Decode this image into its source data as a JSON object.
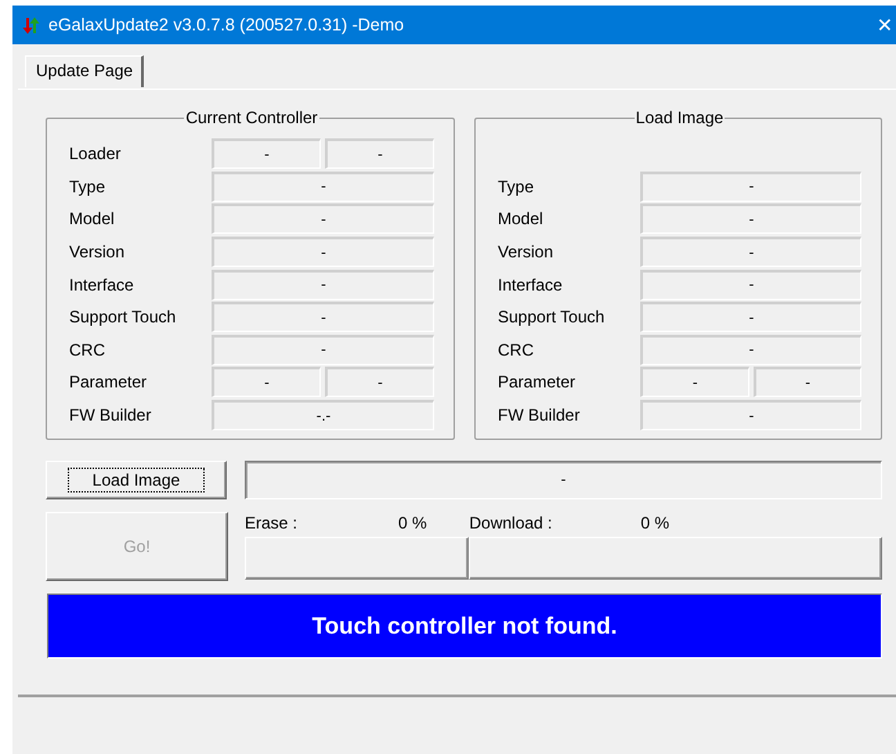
{
  "window": {
    "title": "eGalaxUpdate2 v3.0.7.8 (200527.0.31) -Demo",
    "close": "✕"
  },
  "tabs": [
    {
      "label": "Update Page",
      "selected": true
    }
  ],
  "groups": [
    {
      "title": "Current Controller",
      "rows": [
        {
          "label": "Loader",
          "values": [
            "-",
            "-"
          ]
        },
        {
          "label": "Type",
          "values": [
            "-"
          ]
        },
        {
          "label": "Model",
          "values": [
            "-"
          ]
        },
        {
          "label": "Version",
          "values": [
            "-"
          ]
        },
        {
          "label": "Interface",
          "values": [
            "-"
          ]
        },
        {
          "label": "Support Touch",
          "values": [
            "-"
          ]
        },
        {
          "label": "CRC",
          "values": [
            "-"
          ]
        },
        {
          "label": "Parameter",
          "values": [
            "-",
            "-"
          ]
        },
        {
          "label": "FW Builder",
          "values": [
            "-.-"
          ]
        }
      ]
    },
    {
      "title": "Load Image",
      "rows": [
        {
          "label": "Type",
          "values": [
            "-"
          ]
        },
        {
          "label": "Model",
          "values": [
            "-"
          ]
        },
        {
          "label": "Version",
          "values": [
            "-"
          ]
        },
        {
          "label": "Interface",
          "values": [
            "-"
          ]
        },
        {
          "label": "Support Touch",
          "values": [
            "-"
          ]
        },
        {
          "label": "CRC",
          "values": [
            "-"
          ]
        },
        {
          "label": "Parameter",
          "values": [
            "-",
            "-"
          ]
        },
        {
          "label": "FW Builder",
          "values": [
            "-"
          ]
        }
      ]
    }
  ],
  "load_button": {
    "label": "Load Image",
    "focused": true
  },
  "image_path": "-",
  "go_button": {
    "label": "Go!",
    "disabled": true
  },
  "progress": [
    {
      "label": "Erase :",
      "reading": "0 %",
      "level": 0
    },
    {
      "label": "Download :",
      "reading": "0 %",
      "level": 0
    }
  ],
  "status": "Touch controller not found."
}
